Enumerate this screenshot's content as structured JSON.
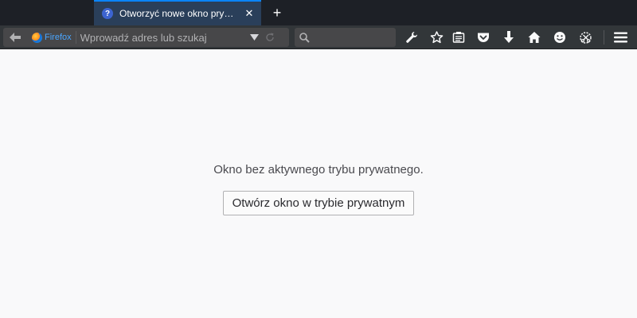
{
  "browser": {
    "name": "Firefox",
    "accent_color": "#0a84ff"
  },
  "tabs": [
    {
      "title": "Otworzyć nowe okno prywatne?",
      "favicon": "question-mark-icon",
      "active": true
    }
  ],
  "tabbar": {
    "new_tab_icon": "plus-icon",
    "close_icon": "close-icon"
  },
  "urlbar": {
    "identity_label": "Firefox",
    "placeholder": "Wprowadź adres lub szukaj",
    "value": ""
  },
  "searchbar": {
    "placeholder": "",
    "value": ""
  },
  "toolbar_icons": [
    "wrench-icon",
    "star-icon",
    "reading-list-icon",
    "pocket-icon",
    "download-icon",
    "home-icon",
    "smiley-icon",
    "screenshot-icon",
    "hamburger-menu-icon"
  ],
  "content": {
    "message": "Okno bez aktywnego trybu prywatnego.",
    "button_label": "Otwórz okno w trybie prywatnym"
  }
}
